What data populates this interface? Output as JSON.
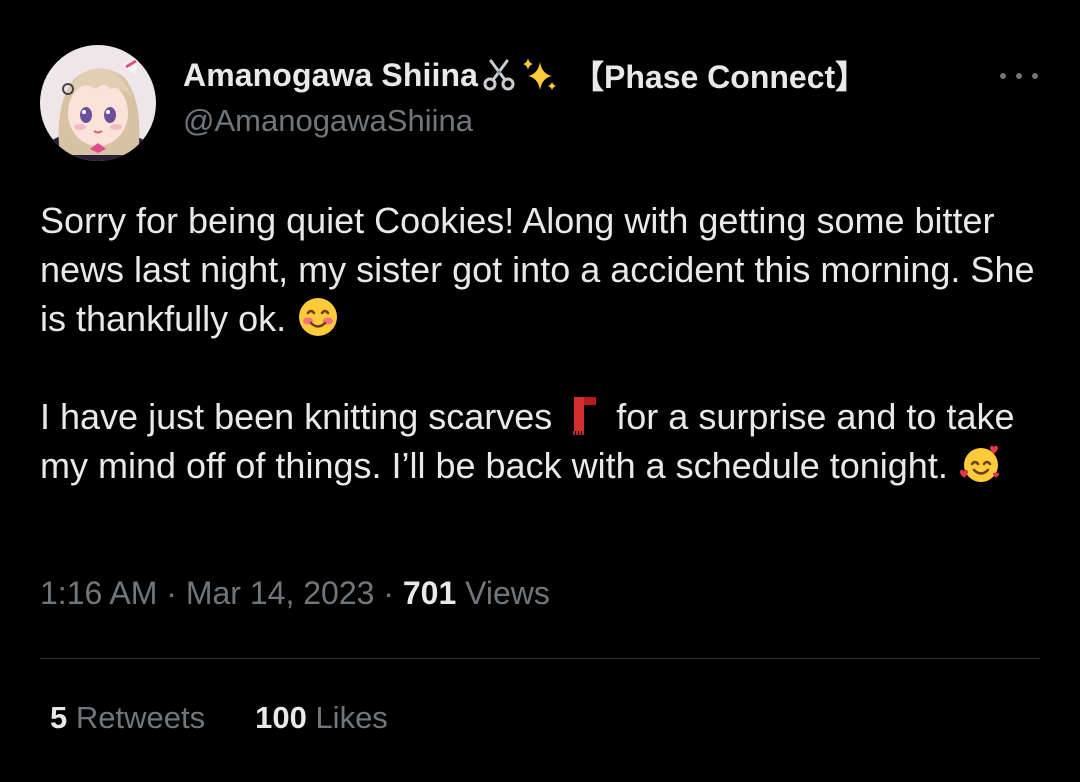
{
  "user": {
    "display_name": "Amanogawa Shiina",
    "name_emojis": [
      "scissors-emoji",
      "sparkles-emoji"
    ],
    "affiliation": "【Phase Connect】",
    "handle": "@AmanogawaShiina"
  },
  "tweet": {
    "paragraph_1": {
      "text_a": "Sorry for being quiet Cookies! Along with getting some bitter news last night, my sister got into a accident this morning. She is thankfully ok. ",
      "emoji": "smiling-face-emoji"
    },
    "paragraph_2": {
      "text_a": "I have just been knitting scarves ",
      "emoji_a": "scarf-emoji",
      "text_b": " for a surprise and to take my mind off of things. I’ll be back with a schedule tonight. ",
      "emoji_b": "smiling-face-with-hearts-emoji"
    }
  },
  "meta": {
    "time": "1:16 AM",
    "separator": " · ",
    "date": "Mar 14, 2023",
    "views_count": "701",
    "views_label": " Views"
  },
  "stats": {
    "retweets_count": "5",
    "retweets_label": " Retweets",
    "likes_count": "100",
    "likes_label": " Likes"
  },
  "colors": {
    "background": "#000000",
    "primary_text": "#e7e9ea",
    "secondary_text": "#71767b",
    "divider": "#2f3336"
  }
}
